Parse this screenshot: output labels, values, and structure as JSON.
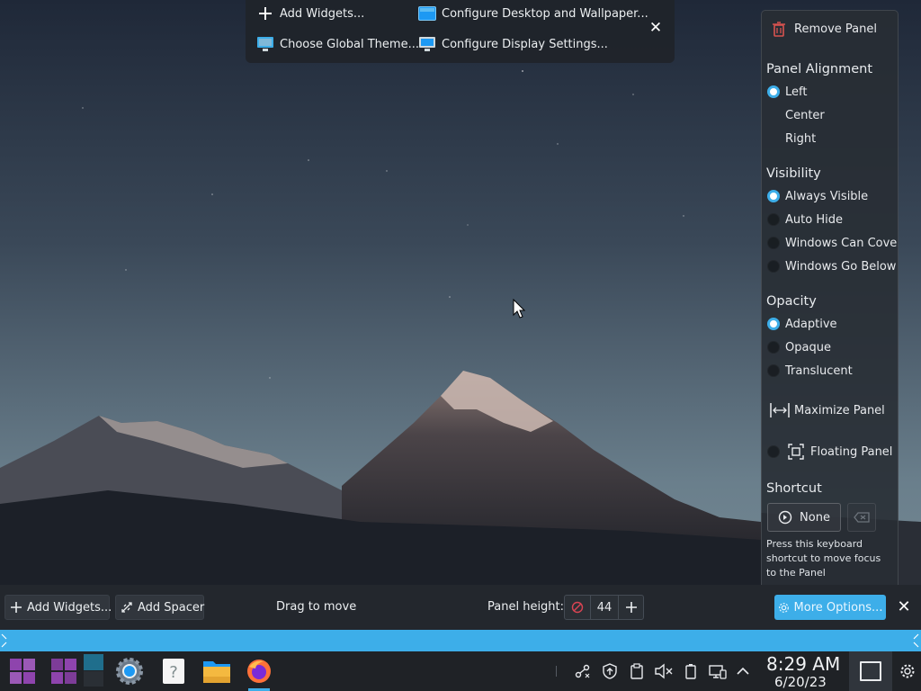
{
  "colors": {
    "accent": "#3daee9",
    "panel_bg": "#23272d",
    "taskbar_bg": "#1f2226",
    "remove_icon": "#d9534f"
  },
  "toolbox": {
    "add_widgets": "Add Widgets...",
    "configure_desktop": "Configure Desktop and Wallpaper...",
    "choose_theme": "Choose Global Theme...",
    "display_settings": "Configure Display Settings...",
    "close_icon": "close-icon"
  },
  "settings": {
    "remove_panel": "Remove Panel",
    "alignment": {
      "heading": "Panel Alignment",
      "options": [
        "Left",
        "Center",
        "Right"
      ],
      "selected": "Left"
    },
    "visibility": {
      "heading": "Visibility",
      "options": [
        "Always Visible",
        "Auto Hide",
        "Windows Can Cover",
        "Windows Go Below"
      ],
      "selected": "Always Visible"
    },
    "opacity": {
      "heading": "Opacity",
      "options": [
        "Adaptive",
        "Opaque",
        "Translucent"
      ],
      "selected": "Adaptive"
    },
    "maximize_panel": "Maximize Panel",
    "floating_panel": "Floating Panel",
    "shortcut": {
      "heading": "Shortcut",
      "value": "None",
      "help": "Press this keyboard shortcut to move focus to the Panel"
    }
  },
  "edit_toolbar": {
    "add_widgets": "Add Widgets...",
    "add_spacer": "Add Spacer",
    "drag_hint": "Drag to move",
    "height_label": "Panel height:",
    "height_value": "44",
    "more_options": "More Options..."
  },
  "taskbar": {
    "apps": [
      "application-launcher-icon",
      "pager-icon",
      "pager-icon",
      "system-settings-icon",
      "help-center-icon",
      "dolphin-file-manager-icon",
      "firefox-icon"
    ],
    "tray": [
      "kde-connect-icon",
      "updates-icon",
      "clipboard-icon",
      "volume-muted-icon",
      "battery-icon",
      "network-icon",
      "show-hidden-icons-icon"
    ],
    "time": "8:29 AM",
    "date": "6/20/23"
  }
}
